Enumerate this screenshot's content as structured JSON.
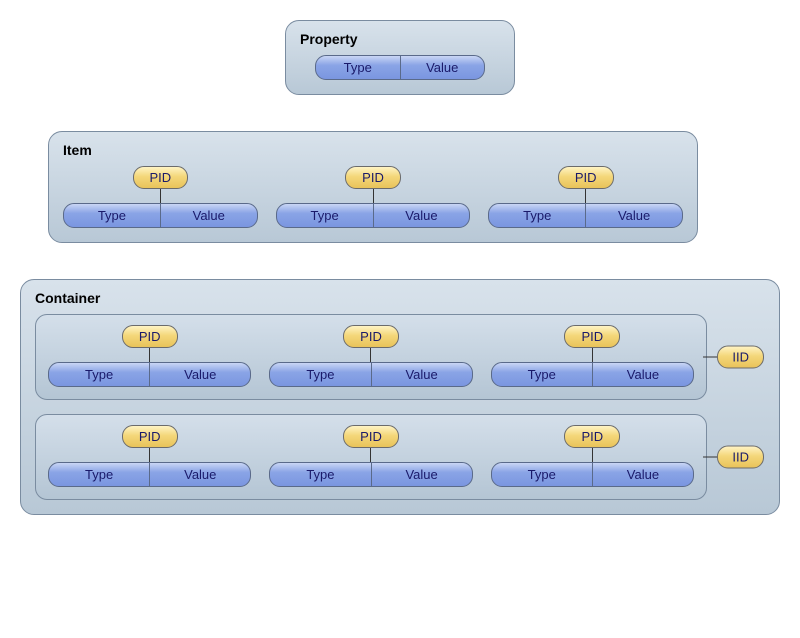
{
  "property": {
    "title": "Property",
    "type_label": "Type",
    "value_label": "Value"
  },
  "item": {
    "title": "Item",
    "units": [
      {
        "pid": "PID",
        "type": "Type",
        "value": "Value"
      },
      {
        "pid": "PID",
        "type": "Type",
        "value": "Value"
      },
      {
        "pid": "PID",
        "type": "Type",
        "value": "Value"
      }
    ]
  },
  "container": {
    "title": "Container",
    "items": [
      {
        "iid": "IID",
        "units": [
          {
            "pid": "PID",
            "type": "Type",
            "value": "Value"
          },
          {
            "pid": "PID",
            "type": "Type",
            "value": "Value"
          },
          {
            "pid": "PID",
            "type": "Type",
            "value": "Value"
          }
        ]
      },
      {
        "iid": "IID",
        "units": [
          {
            "pid": "PID",
            "type": "Type",
            "value": "Value"
          },
          {
            "pid": "PID",
            "type": "Type",
            "value": "Value"
          },
          {
            "pid": "PID",
            "type": "Type",
            "value": "Value"
          }
        ]
      }
    ]
  }
}
